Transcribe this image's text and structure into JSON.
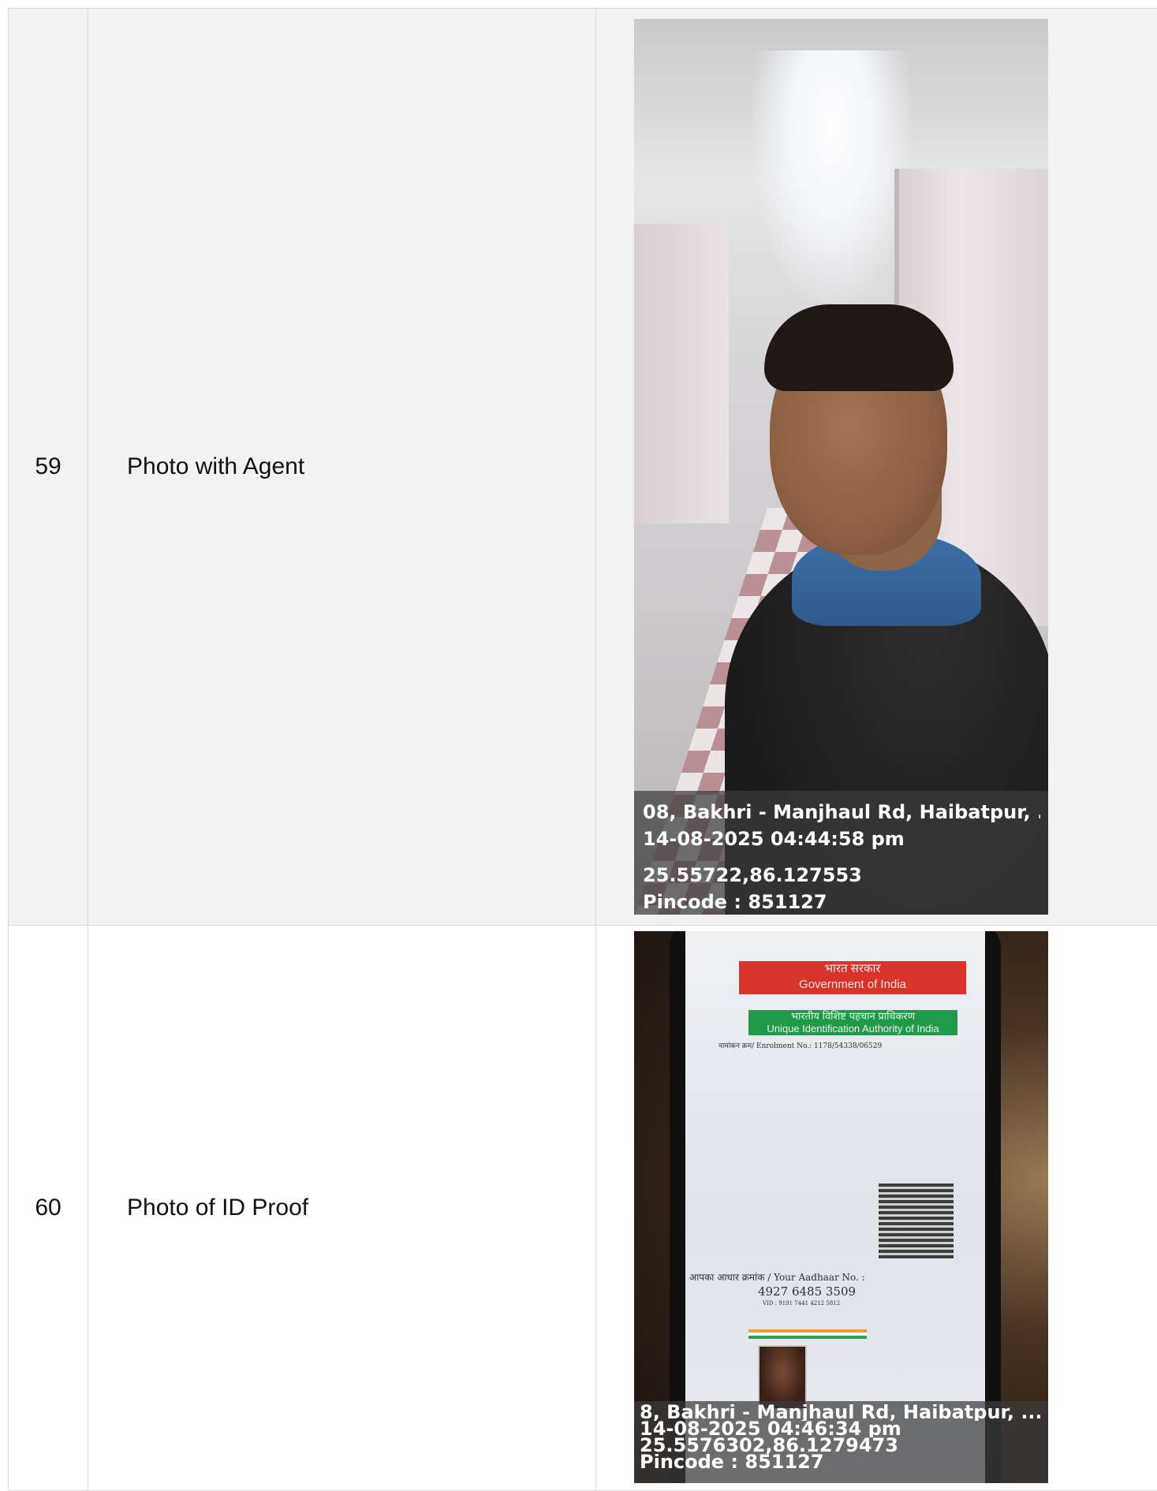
{
  "rows": [
    {
      "number": "59",
      "label": "Photo with Agent",
      "geotag": {
        "address": "08, Bakhri - Manjhaul Rd, Haibatpur, ...",
        "datetime": "14-08-2025 04:44:58 pm",
        "coords": "25.55722,86.127553",
        "pincode": "Pincode : 851127"
      }
    },
    {
      "number": "60",
      "label": "Photo of ID Proof",
      "geotag": {
        "address": "8, Bakhri - Manjhaul Rd, Haibatpur, ...",
        "datetime": "14-08-2025 04:46:34 pm",
        "coords": "25.5576302,86.1279473",
        "pincode": "Pincode : 851127"
      },
      "id_card": {
        "header_hi": "भारत सरकार",
        "header_en": "Government of India",
        "authority_hi": "भारतीय विशिष्ट पहचान प्राधिकरण",
        "authority_en": "Unique Identification Authority of India",
        "enrolment": "नामांकन क्रम/ Enrolment No.: 1178/54338/06529",
        "aadhaar_label": "आपका आधार क्रमांक / Your Aadhaar No. :",
        "aadhaar_number": "4927 6485 3509",
        "vid": "VID : 9191 7441 4212 5812"
      }
    }
  ]
}
